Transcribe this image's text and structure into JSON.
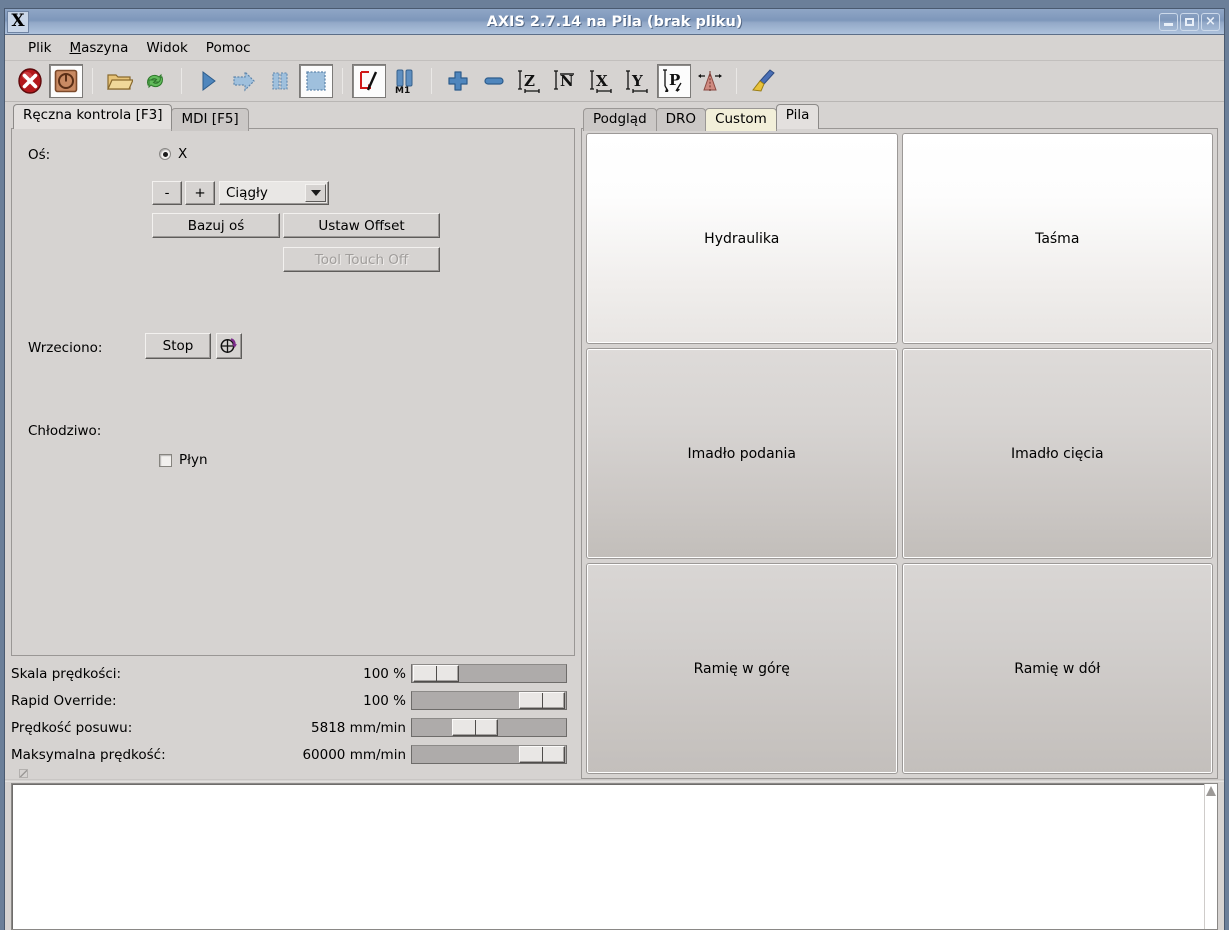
{
  "window": {
    "title": "AXIS 2.7.14 na Pila (brak pliku)",
    "icon_label": "X",
    "minimize_label": "",
    "maximize_label": "",
    "close_label": "×"
  },
  "menubar": {
    "items": [
      {
        "label": "Plik",
        "mnemonic": ""
      },
      {
        "label": "Maszyna",
        "mnemonic": "M"
      },
      {
        "label": "Widok",
        "mnemonic": ""
      },
      {
        "label": "Pomoc",
        "mnemonic": ""
      }
    ]
  },
  "toolbar": {
    "buttons": [
      {
        "name": "estop-icon",
        "tip": "E-Stop"
      },
      {
        "name": "machine-power-icon",
        "tip": "Power",
        "pressed": true
      },
      {
        "name": "open-file-icon",
        "tip": "Otwórz"
      },
      {
        "name": "reload-file-icon",
        "tip": "Przeładuj"
      },
      {
        "name": "run-program-icon",
        "tip": "Start"
      },
      {
        "name": "step-program-icon",
        "tip": "Krok"
      },
      {
        "name": "pause-program-icon",
        "tip": "Pauza"
      },
      {
        "name": "stop-program-icon",
        "tip": "Stop",
        "pressed": true
      },
      {
        "name": "toggle-skip-lines-icon",
        "tip": "Pomiń linie"
      },
      {
        "name": "optional-stop-icon",
        "tip": "M1"
      },
      {
        "name": "zoom-in-icon",
        "tip": "Powiększ"
      },
      {
        "name": "zoom-out-icon",
        "tip": "Pomniejsz"
      },
      {
        "name": "view-z-icon",
        "tip": "Widok Z"
      },
      {
        "name": "view-z2-icon",
        "tip": "Widok Z2"
      },
      {
        "name": "view-x-icon",
        "tip": "Widok X"
      },
      {
        "name": "view-y-icon",
        "tip": "Widok Y"
      },
      {
        "name": "view-p-icon",
        "tip": "Widok P",
        "pressed": true
      },
      {
        "name": "tool-cone-icon",
        "tip": "Narzędzie"
      },
      {
        "name": "clear-plot-icon",
        "tip": "Wyczyść"
      }
    ]
  },
  "left_panel": {
    "tabs": [
      {
        "label": "Ręczna kontrola [F3]",
        "selected": true
      },
      {
        "label": "MDI [F5]",
        "selected": false
      }
    ],
    "manual": {
      "axis_label": "Oś:",
      "axis_options": [
        "X"
      ],
      "axis_selected": "X",
      "jog_minus": "-",
      "jog_plus": "+",
      "jog_increment_value": "Ciągły",
      "jog_increment_options": [
        "Ciągły"
      ],
      "home_axis_label": "Bazuj oś",
      "set_offset_label": "Ustaw Offset",
      "tool_touch_off_label": "Tool Touch Off",
      "tool_touch_off_disabled": true,
      "spindle_label": "Wrzeciono:",
      "spindle_stop_label": "Stop",
      "spindle_dir_icon": "spindle-cw-icon",
      "coolant_label": "Chłodziwo:",
      "coolant_flood_label": "Płyn",
      "coolant_flood_checked": false
    }
  },
  "sliders": [
    {
      "name": "feed-override",
      "label": "Skala prędkości:",
      "value": "100 %",
      "thumb_pct": 3
    },
    {
      "name": "rapid-override",
      "label": "Rapid Override:",
      "value": "100 %",
      "thumb_pct": 90
    },
    {
      "name": "feed-rate",
      "label": "Prędkość posuwu:",
      "value": "5818 mm/min",
      "thumb_pct": 32
    },
    {
      "name": "max-velocity",
      "label": "Maksymalna prędkość:",
      "value": "60000 mm/min",
      "thumb_pct": 90
    }
  ],
  "right_panel": {
    "tabs": [
      {
        "label": "Podgląd",
        "selected": false,
        "style": "normal"
      },
      {
        "label": "DRO",
        "selected": false,
        "style": "normal"
      },
      {
        "label": "Custom",
        "selected": false,
        "style": "custom"
      },
      {
        "label": "Pila",
        "selected": true,
        "style": "normal"
      }
    ],
    "pila_buttons": [
      {
        "label": "Hydraulika",
        "style": "light"
      },
      {
        "label": "Taśma",
        "style": "light"
      },
      {
        "label": "Imadło podania",
        "style": "mid"
      },
      {
        "label": "Imadło cięcia",
        "style": "mid"
      },
      {
        "label": "Ramię w górę",
        "style": "dark"
      },
      {
        "label": "Ramię w dół",
        "style": "dark"
      }
    ]
  },
  "console": {
    "text": ""
  },
  "colors": {
    "titlebar_active": "#7e97ba",
    "bg": "#d6d3d1",
    "custom_tab": "#f2efd9",
    "estop_red": "#c0392b",
    "spindle_purple": "#7c2b8a"
  }
}
